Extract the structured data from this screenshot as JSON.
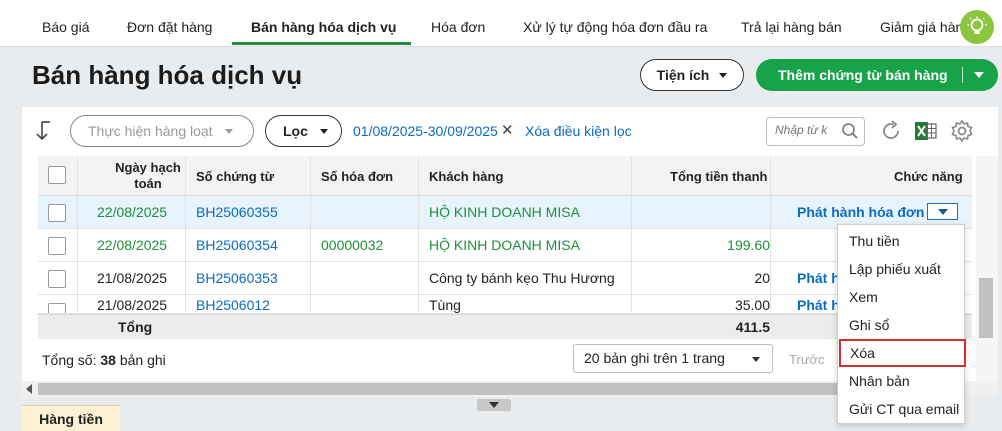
{
  "tabs": [
    {
      "label": "Báo giá"
    },
    {
      "label": "Đơn đặt hàng"
    },
    {
      "label": "Bán hàng hóa dịch vụ"
    },
    {
      "label": "Hóa đơn"
    },
    {
      "label": "Xử lý tự động hóa đơn đầu ra"
    },
    {
      "label": "Trả lại hàng bán"
    },
    {
      "label": "Giảm giá hàn"
    }
  ],
  "colors": {
    "accent": "#17a34a",
    "link": "#0a6bc2",
    "highlight_border": "#d32f2f"
  },
  "page": {
    "title": "Bán hàng hóa dịch vụ"
  },
  "buttons": {
    "utilities": "Tiện ích",
    "add_voucher": "Thêm chứng từ bán hàng"
  },
  "toolbar": {
    "batch_placeholder": "Thực hiện hàng loạt",
    "filter_label": "Lọc",
    "date_range": "01/08/2025-30/09/2025",
    "clear_filter": "Xóa điều kiện lọc",
    "search_placeholder": "Nhập từ k"
  },
  "table": {
    "headers": {
      "date": "Ngày hạch toán",
      "voucher_no": "Số chứng từ",
      "invoice_no": "Số hóa đơn",
      "customer": "Khách hàng",
      "total": "Tổng tiền thanh",
      "actions": "Chức năng"
    },
    "rows": [
      {
        "date": "22/08/2025",
        "voucher_no": "BH25060355",
        "invoice_no": "",
        "customer": "HỘ KINH DOANH MISA",
        "total": "",
        "action": "Phát hành hóa đơn"
      },
      {
        "date": "22/08/2025",
        "voucher_no": "BH25060354",
        "invoice_no": "00000032",
        "customer": "HỘ KINH DOANH MISA",
        "total": "199.60",
        "action": ""
      },
      {
        "date": "21/08/2025",
        "voucher_no": "BH25060353",
        "invoice_no": "",
        "customer": "Công ty bánh kẹo Thu Hương",
        "total": "20",
        "action": "Phát h"
      },
      {
        "date": "21/08/2025",
        "voucher_no": "BH2506012",
        "invoice_no": "",
        "customer": "Tùng",
        "total": "35.00",
        "action": "Phát h"
      }
    ],
    "total_label": "Tổng",
    "total_value": "411.5"
  },
  "footer": {
    "count_prefix": "Tổng số: ",
    "count_value": "38",
    "count_suffix": " bản ghi",
    "page_size": "20 bản ghi trên 1 trang",
    "prev": "Trước"
  },
  "bottom_tab": "Hàng tiền",
  "menu": {
    "items": [
      "Thu tiền",
      "Lập phiếu xuất",
      "Xem",
      "Ghi sổ",
      "Xóa",
      "Nhân bản",
      "Gửi CT qua email"
    ],
    "highlighted": "Xóa"
  }
}
